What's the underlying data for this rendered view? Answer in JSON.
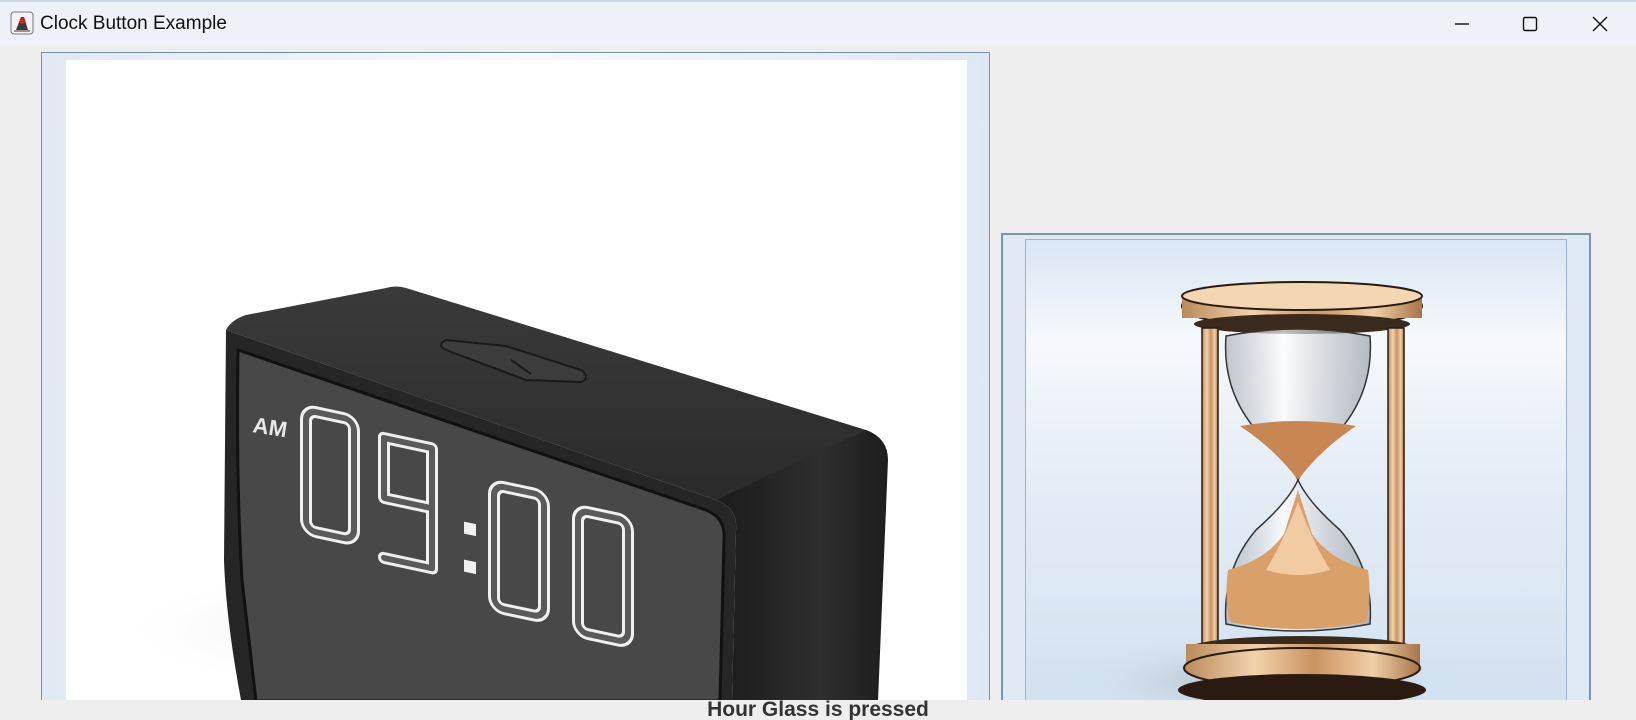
{
  "window": {
    "title": "Clock Button Example",
    "app_icon": "java-duke-icon",
    "controls": {
      "minimize_icon": "minimize-icon",
      "maximize_icon": "maximize-icon",
      "close_icon": "close-icon"
    }
  },
  "buttons": [
    {
      "name": "clock-button",
      "image": "digital-alarm-clock-image",
      "clock_display": {
        "period": "AM",
        "hours": "09",
        "separator": ":",
        "minutes": "00"
      }
    },
    {
      "name": "hourglass-button",
      "image": "hourglass-image"
    }
  ],
  "status": {
    "text": "Hour Glass is pressed"
  },
  "colors": {
    "window_bg": "#eeeeee",
    "titlebar_bg": "#eef1f7",
    "button_border": "#7a94b5",
    "clock_body": "#2a2a2a",
    "lcd_bg": "#4a4a4a",
    "digit_color": "#f2f2f2",
    "sand": "#c98a55",
    "hourglass_frame": "#e2b98c"
  }
}
